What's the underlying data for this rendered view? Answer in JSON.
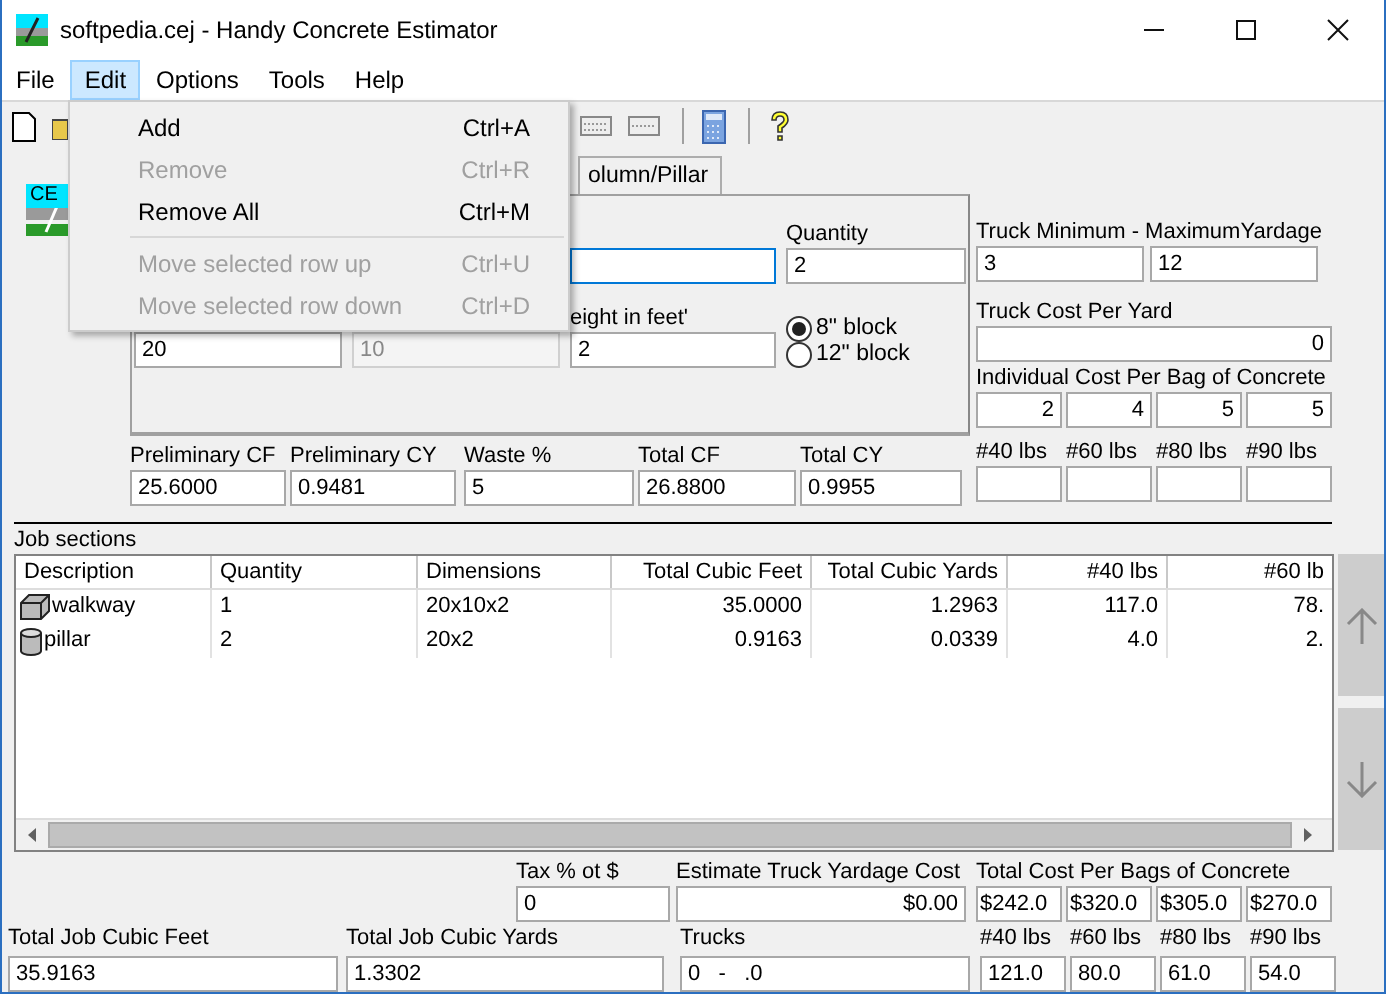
{
  "window": {
    "title": "softpedia.cej - Handy Concrete Estimator"
  },
  "menu_bar": [
    {
      "label": "File",
      "selected": false
    },
    {
      "label": "Edit",
      "selected": true
    },
    {
      "label": "Options",
      "selected": false
    },
    {
      "label": "Tools",
      "selected": false
    },
    {
      "label": "Help",
      "selected": false
    }
  ],
  "edit_menu": {
    "groups": [
      [
        {
          "label": "Add",
          "shortcut": "Ctrl+A",
          "disabled": false
        },
        {
          "label": "Remove",
          "shortcut": "Ctrl+R",
          "disabled": true
        },
        {
          "label": "Remove All",
          "shortcut": "Ctrl+M",
          "disabled": false
        }
      ],
      [
        {
          "label": "Move selected row up",
          "shortcut": "Ctrl+U",
          "disabled": true
        },
        {
          "label": "Move selected row down",
          "shortcut": "Ctrl+D",
          "disabled": true
        }
      ]
    ]
  },
  "logo": {
    "text": "CE"
  },
  "tabs": [
    {
      "label": "olumn/Pillar",
      "selected": true
    }
  ],
  "panel": {
    "upper_fields": [
      {
        "focused": true
      },
      {
        "label": "Quantity",
        "value": "2",
        "focused": false
      }
    ],
    "lower_fields": [
      {
        "value": "20",
        "disabled": false
      },
      {
        "value": "10",
        "disabled": true
      },
      {
        "label": "eight in feet'",
        "value": "2",
        "disabled": false
      }
    ],
    "block_options": [
      {
        "label": "8\" block",
        "selected": true
      },
      {
        "label": "12\" block",
        "selected": false
      }
    ]
  },
  "summary_fields": [
    {
      "label": "Preliminary CF",
      "value": "25.6000"
    },
    {
      "label": "Preliminary CY",
      "value": "0.9481"
    },
    {
      "label": "Waste %",
      "value": "5"
    },
    {
      "label": "Total CF",
      "value": "26.8800"
    },
    {
      "label": "Total CY",
      "value": "0.9955"
    }
  ],
  "truck_yardage": {
    "label": "Truck Minimum - MaximumYardage",
    "values": [
      "3",
      "12"
    ]
  },
  "truck_cost": {
    "label": "Truck Cost Per Yard",
    "value": "0"
  },
  "bag_cost": {
    "label": "Individual Cost Per Bag of Concrete",
    "values": [
      "2",
      "4",
      "5",
      "5"
    ]
  },
  "bag_sizes": [
    "#40 lbs",
    "#60 lbs",
    "#80 lbs",
    "#90 lbs"
  ],
  "job_sections": {
    "title": "Job sections",
    "columns": [
      "Description",
      "Quantity",
      "Dimensions",
      "Total Cubic Feet",
      "Total Cubic Yards",
      "#40 lbs",
      "#60 lb"
    ],
    "rows": [
      {
        "kind": "block",
        "cells": [
          "walkway",
          "1",
          "20x10x2",
          "35.0000",
          "1.2963",
          "117.0",
          "78."
        ]
      },
      {
        "kind": "cylinder",
        "cells": [
          "pillar",
          "2",
          "20x2",
          "0.9163",
          "0.0339",
          "4.0",
          "2."
        ]
      }
    ]
  },
  "tax": {
    "label": "Tax % ot $",
    "value": "0"
  },
  "truck_yardage_cost": {
    "label": "Estimate Truck Yardage Cost",
    "value": "$0.00"
  },
  "bag_totals": {
    "label": "Total Cost Per Bags of Concrete",
    "values": [
      "$242.0",
      "$320.0",
      "$305.0",
      "$270.0"
    ]
  },
  "total_cubic_feet": {
    "label": "Total Job Cubic Feet",
    "value": "35.9163"
  },
  "total_cubic_yards": {
    "label": "Total Job Cubic Yards",
    "value": "1.3302"
  },
  "trucks": {
    "label": "Trucks",
    "value": "0   -   .0"
  },
  "bag_counts": [
    {
      "label": "#40 lbs",
      "value": "121.0"
    },
    {
      "label": "#60 lbs",
      "value": "80.0"
    },
    {
      "label": "#80 lbs",
      "value": "61.0"
    },
    {
      "label": "#90 lbs",
      "value": "54.0"
    }
  ]
}
